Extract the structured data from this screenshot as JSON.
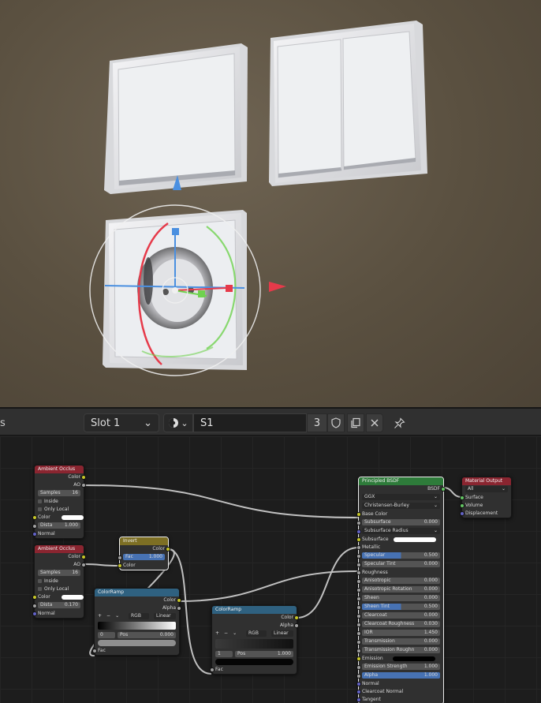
{
  "header": {
    "cut_label": "s",
    "slot": "Slot 1",
    "material_name": "S1",
    "user_count": "3",
    "colors": {
      "bar": "#303030",
      "field": "#282828"
    }
  },
  "icons": [
    "shading-sphere-icon",
    "chevron-down-icon",
    "fake-user-shield-icon",
    "duplicate-icon",
    "close-icon",
    "pin-icon"
  ],
  "nodes": {
    "ao1": {
      "title": "Ambient Occlus",
      "color_out": "Color",
      "ao_out": "AO",
      "samples_label": "Samples",
      "samples_value": "16",
      "inside": "Inside",
      "only_local": "Only Local",
      "color_in": "Color",
      "dist_label": "Dista",
      "dist_value": "1.000",
      "normal": "Normal"
    },
    "ao2": {
      "title": "Ambient Occlus",
      "color_out": "Color",
      "ao_out": "AO",
      "samples_label": "Samples",
      "samples_value": "16",
      "inside": "Inside",
      "only_local": "Only Local",
      "color_in": "Color",
      "dist_label": "Dista",
      "dist_value": "0.170",
      "normal": "Normal"
    },
    "invert": {
      "title": "Invert",
      "color_out": "Color",
      "fac_label": "Fac",
      "fac_value": "1.000",
      "color_in": "Color"
    },
    "ramp1": {
      "title": "ColorRamp",
      "color_out": "Color",
      "alpha_out": "Alpha",
      "add": "+",
      "remove": "−",
      "menu": "⌄",
      "mode": "RGB",
      "interp": "Linear",
      "index": "0",
      "pos_label": "Pos",
      "pos_value": "0.000",
      "fac": "Fac"
    },
    "ramp2": {
      "title": "ColorRamp",
      "color_out": "Color",
      "alpha_out": "Alpha",
      "add": "+",
      "remove": "−",
      "menu": "⌄",
      "mode": "RGB",
      "interp": "Linear",
      "index": "1",
      "pos_label": "Pos",
      "pos_value": "1.000",
      "fac": "Fac"
    },
    "bsdf": {
      "title": "Principled BSDF",
      "out": "BSDF",
      "distribution": "GGX",
      "sss_method": "Christensen-Burley",
      "base_color": "Base Color",
      "subsurface_label": "Subsurface",
      "subsurface_value": "0.000",
      "subsurface_radius": "Subsurface Radius",
      "subsurface_color": "Subsurface",
      "metallic": "Metallic",
      "specular_label": "Specular",
      "specular_value": "0.500",
      "specular_tint_label": "Specular Tint",
      "specular_tint_value": "0.000",
      "roughness": "Roughness",
      "anisotropic_label": "Anisotropic",
      "anisotropic_value": "0.000",
      "aniso_rot_label": "Anisotropic Rotation",
      "aniso_rot_value": "0.000",
      "sheen_label": "Sheen",
      "sheen_value": "0.000",
      "sheen_tint_label": "Sheen Tint",
      "sheen_tint_value": "0.500",
      "clearcoat_label": "Clearcoat",
      "clearcoat_value": "0.000",
      "cc_rough_label": "Clearcoat Roughness",
      "cc_rough_value": "0.030",
      "ior_label": "IOR",
      "ior_value": "1.450",
      "transmission_label": "Transmission",
      "transmission_value": "0.000",
      "trans_rough_label": "Transmission Roughn",
      "trans_rough_value": "0.000",
      "emission": "Emission",
      "emission_strength_label": "Emission Strength",
      "emission_strength_value": "1.000",
      "alpha_label": "Alpha",
      "alpha_value": "1.000",
      "normal": "Normal",
      "clearcoat_normal": "Clearcoat Normal",
      "tangent": "Tangent"
    },
    "output": {
      "title": "Material Output",
      "target": "All",
      "surface": "Surface",
      "volume": "Volume",
      "displacement": "Displacement"
    }
  },
  "colors": {
    "ao_header": "#8a2530",
    "invert_header": "#7d6f24",
    "ramp_header": "#2f6180",
    "bsdf_header": "#2e7b3a",
    "link": "#c0c0c0"
  }
}
